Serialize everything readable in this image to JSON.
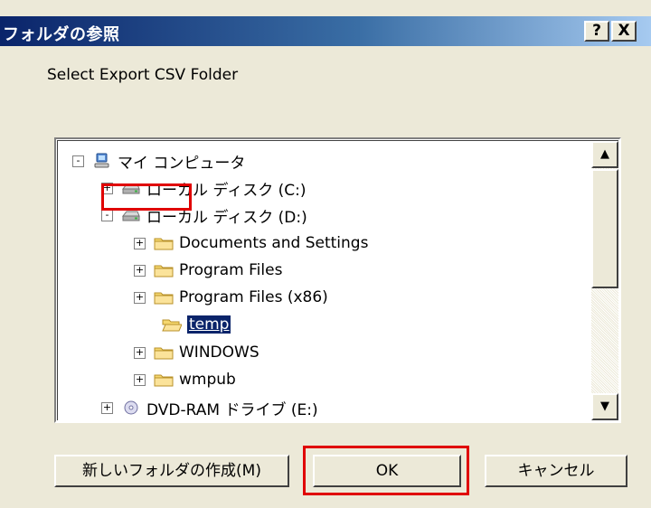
{
  "window": {
    "title": "フォルダの参照",
    "help_label": "?",
    "close_label": "X"
  },
  "prompt": "Select Export CSV Folder",
  "tree": {
    "items": [
      {
        "label": "マイ コンピュータ",
        "icon": "my-computer-icon",
        "expander": "-"
      },
      {
        "label": "ローカル ディスク (C:)",
        "icon": "drive-icon",
        "expander": "+"
      },
      {
        "label": "ローカル ディスク (D:)",
        "icon": "drive-icon",
        "expander": "-"
      },
      {
        "label": "Documents and Settings",
        "icon": "folder-icon",
        "expander": "+"
      },
      {
        "label": "Program Files",
        "icon": "folder-icon",
        "expander": "+"
      },
      {
        "label": "Program Files (x86)",
        "icon": "folder-icon",
        "expander": "+"
      },
      {
        "label": "temp",
        "icon": "open-folder-icon",
        "expander": "",
        "selected": true
      },
      {
        "label": "WINDOWS",
        "icon": "folder-icon",
        "expander": "+"
      },
      {
        "label": "wmpub",
        "icon": "folder-icon",
        "expander": "+"
      },
      {
        "label": "DVD-RAM ドライブ (E:)",
        "icon": "dvd-drive-icon",
        "expander": "+"
      }
    ]
  },
  "scrollbar": {
    "up_arrow": "▲",
    "down_arrow": "▼"
  },
  "buttons": {
    "new_folder": "新しいフォルダの作成(M)",
    "ok": "OK",
    "cancel": "キャンセル"
  },
  "colors": {
    "dialog_bg": "#ece9d8",
    "title_start": "#0a246a",
    "title_end": "#a6caf0",
    "selection": "#0a246a",
    "annotation": "#e00000"
  }
}
